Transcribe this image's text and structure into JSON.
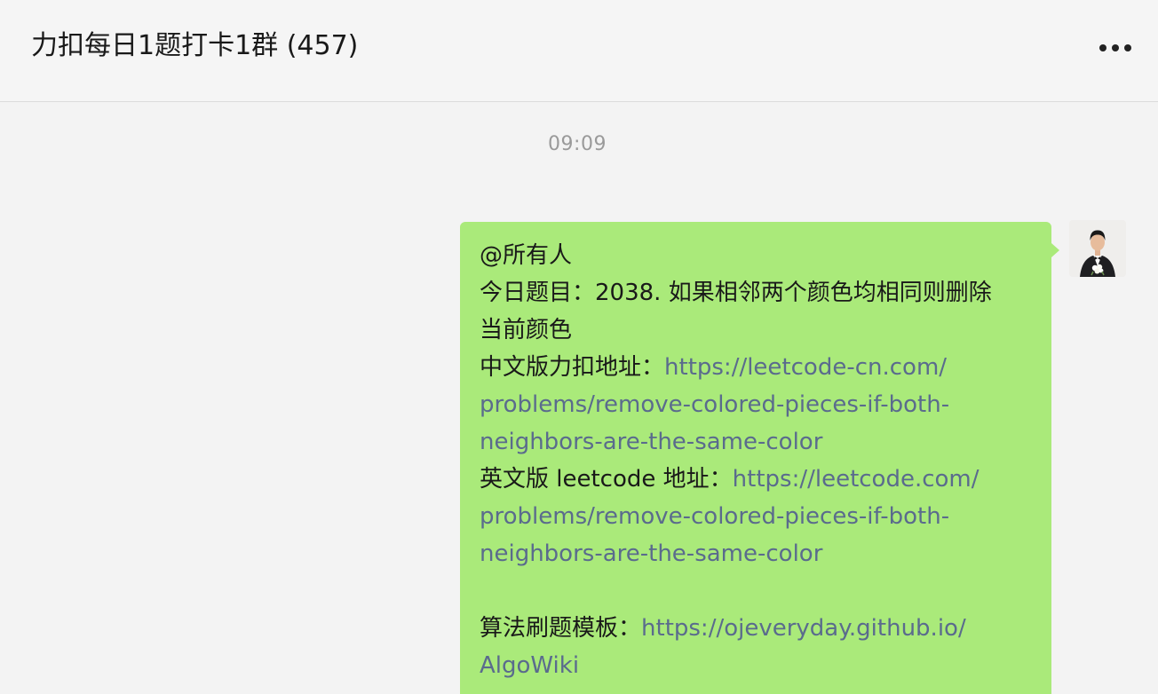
{
  "chat": {
    "title": "力扣每日1题打卡1群 (457)",
    "more_icon": "more-dots-icon"
  },
  "timestamp": "09:09",
  "message": {
    "sender_avatar": "user-avatar",
    "bubble_color": "#aaea7a",
    "link_color": "#5a6b8d",
    "lines": {
      "l1": "@所有人",
      "l2": "今日题目：2038. 如果相邻两个颜色均相同则删除",
      "l3": "当前颜色",
      "l4_label": "中文版力扣地址：",
      "l4_link": "https://leetcode-cn.com/",
      "l5_link": "problems/remove-colored-pieces-if-both-",
      "l6_link": "neighbors-are-the-same-color",
      "l7_label": "英文版 leetcode 地址：",
      "l7_link": "https://leetcode.com/",
      "l8_link": "problems/remove-colored-pieces-if-both-",
      "l9_link": "neighbors-are-the-same-color",
      "l11_label": "算法刷题模板：",
      "l11_link": "https://ojeveryday.github.io/",
      "l12_link": "AlgoWiki"
    }
  }
}
